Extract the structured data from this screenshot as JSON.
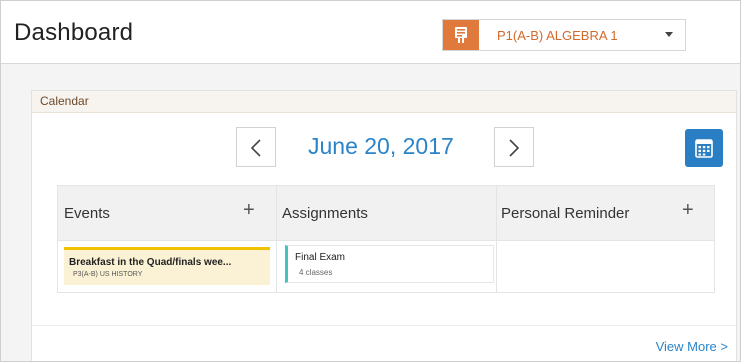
{
  "header": {
    "title": "Dashboard",
    "class_select": {
      "selected": "P1(A-B) ALGEBRA 1",
      "icon": "classroom-board-icon",
      "accent": "#e07a3c"
    }
  },
  "calendar": {
    "title": "Calendar",
    "date": "June 20, 2017",
    "prev_icon": "chevron-left-icon",
    "next_icon": "chevron-right-icon",
    "calendar_icon": "calendar-grid-icon",
    "columns": [
      {
        "label": "Events",
        "add": "+"
      },
      {
        "label": "Assignments"
      },
      {
        "label": "Personal Reminder",
        "add": "+"
      }
    ],
    "events": [
      {
        "title": "Breakfast in the Quad/finals wee...",
        "class": "P3(A-B) US HISTORY",
        "color": "#f2c200"
      }
    ],
    "assignments": [
      {
        "title": "Final Exam",
        "detail": "4 classes",
        "color": "#3ec7c2"
      }
    ],
    "view_more": "View More >"
  },
  "colors": {
    "accent_blue": "#2a84c8",
    "calendar_button": "#2a7fc4"
  }
}
